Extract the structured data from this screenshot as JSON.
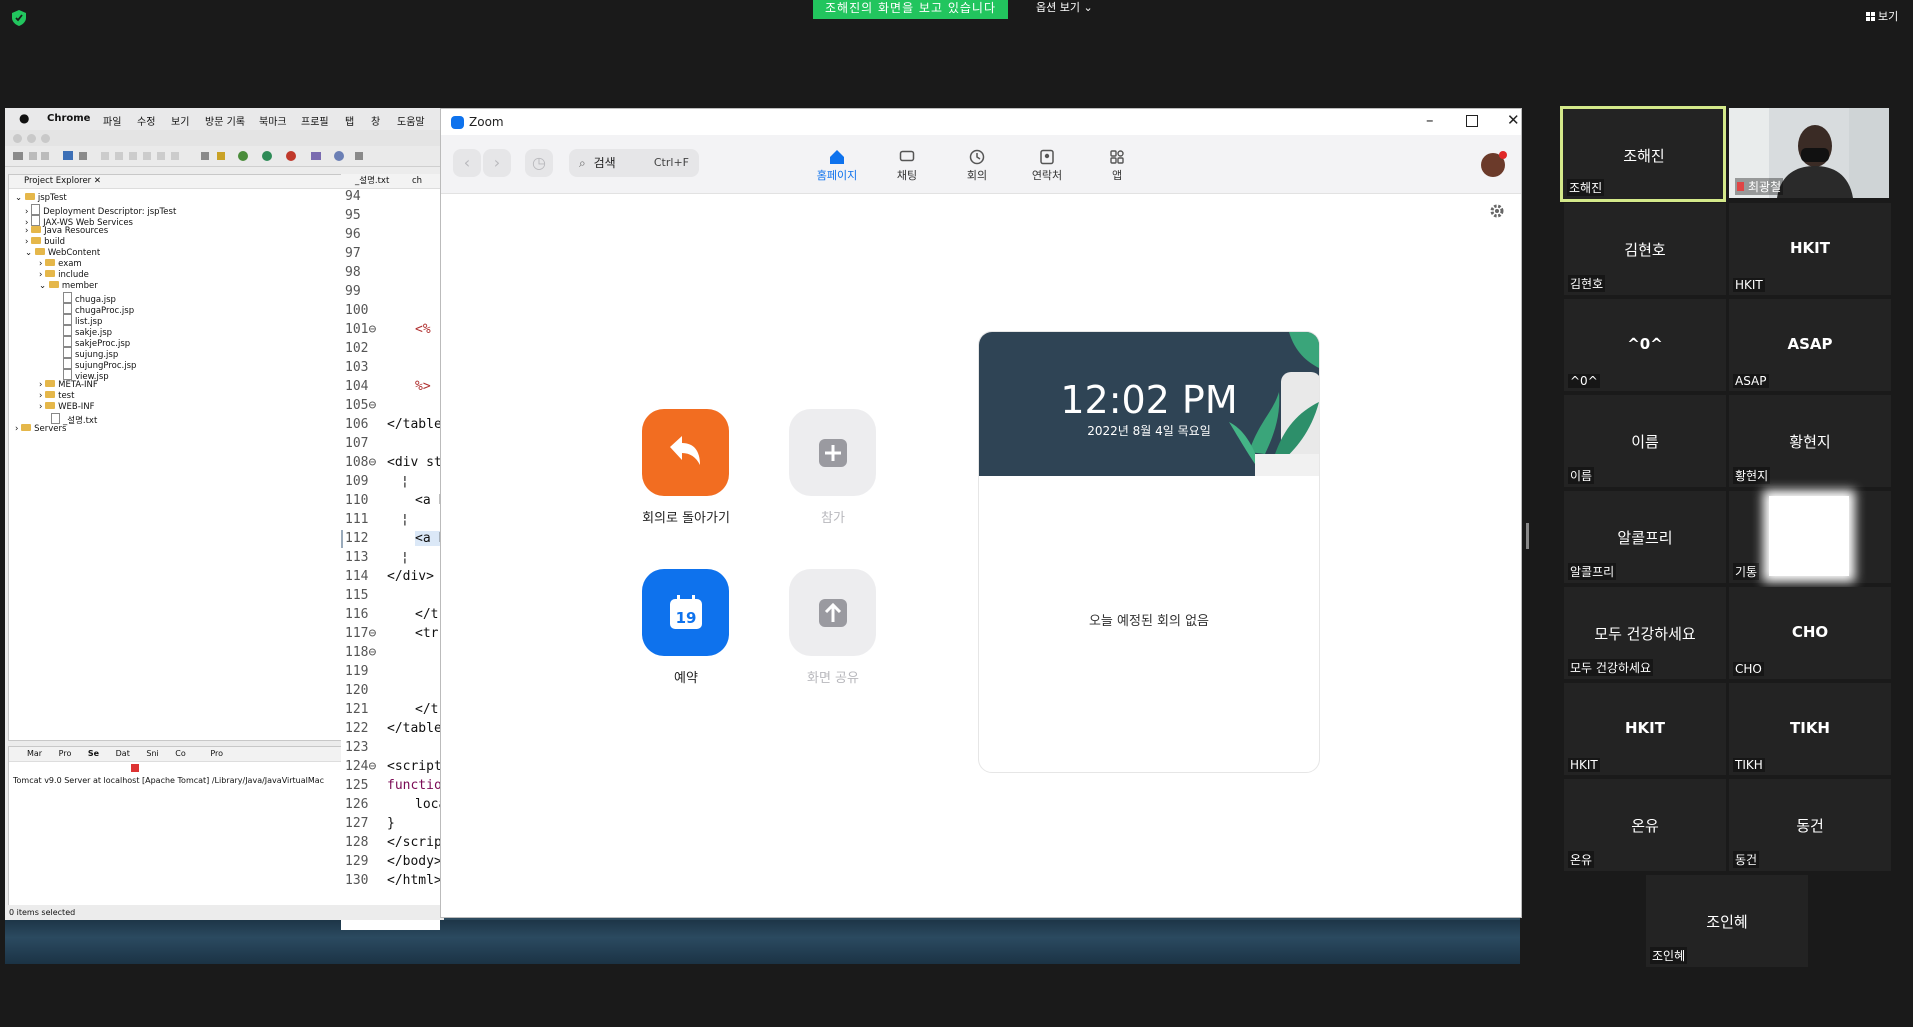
{
  "banner": {
    "viewing": "조해진의 화면을 보고 있습니다",
    "view_options": "옵션 보기 ⌄",
    "view": "보기"
  },
  "mac_menu": [
    "Chrome",
    "파일",
    "수정",
    "보기",
    "방문 기록",
    "북마크",
    "프로필",
    "탭",
    "창",
    "도움말"
  ],
  "eclipse": {
    "explorer_title": "Project Explorer",
    "tree": [
      "jspTest",
      "Deployment Descriptor: jspTest",
      "JAX-WS Web Services",
      "Java Resources",
      "build",
      "WebContent",
      "exam",
      "include",
      "member",
      "chuga.jsp",
      "chugaProc.jsp",
      "list.jsp",
      "sakje.jsp",
      "sakjeProc.jsp",
      "sujung.jsp",
      "sujungProc.jsp",
      "view.jsp",
      "META-INF",
      "test",
      "WEB-INF",
      "_설명.txt",
      "Servers"
    ],
    "editor_tab": "_설명.txt",
    "editor_tab2": "ch",
    "line_numbers": [
      "94",
      "95",
      "96",
      "97",
      "98",
      "99",
      "100",
      "101⊖",
      "102",
      "103",
      "104",
      "105⊖",
      "106",
      "107",
      "108⊖",
      "109",
      "110",
      "111",
      "112",
      "113",
      "114",
      "115",
      "116",
      "117⊖",
      "118⊖",
      "119",
      "120",
      "121",
      "122",
      "123",
      "124⊖",
      "125",
      "126",
      "127",
      "128",
      "129",
      "130"
    ],
    "code": {
      "101": "<%",
      "104": "%>",
      "106": "</table",
      "108": "<div sty",
      "109": "¦",
      "110": "<a h",
      "111": "¦",
      "112": "<a h",
      "113": "¦",
      "114": "</div>",
      "116": "</t",
      "117": "<tr",
      "121": "</t",
      "122": "</table",
      "124": "<script",
      "125": "function",
      "126": "loca",
      "127": "}",
      "128": "</scrip",
      "129": "</body>",
      "130": "</html>"
    },
    "console_tabs": [
      "Mar",
      "Pro",
      "Se",
      "Dat",
      "Sni",
      "Co",
      "Pro"
    ],
    "console_text": "Tomcat v9.0 Server at localhost [Apache Tomcat] /Library/Java/JavaVirtualMac",
    "status": "0 items selected"
  },
  "zoom": {
    "title": "Zoom",
    "search_label": "검색",
    "search_shortcut": "Ctrl+F",
    "tabs": [
      "홈페이지",
      "채팅",
      "회의",
      "연락처",
      "앱"
    ],
    "actions": {
      "return": "회의로 돌아가기",
      "join": "참가",
      "schedule": "예약",
      "share": "화면 공유",
      "calendar_day": "19"
    },
    "clock": {
      "time": "12:02 PM",
      "date": "2022년 8월 4일 목요일"
    },
    "no_meetings": "오늘 예정된 회의 없음"
  },
  "participants": [
    {
      "name": "조해진",
      "label": "조해진"
    },
    {
      "name": "",
      "label": "최광철"
    },
    {
      "name": "김현호",
      "label": "김현호"
    },
    {
      "name": "HKIT",
      "label": "HKIT"
    },
    {
      "name": "^0^",
      "label": "^0^"
    },
    {
      "name": "ASAP",
      "label": "ASAP"
    },
    {
      "name": "이름",
      "label": "이름"
    },
    {
      "name": "황현지",
      "label": "황현지"
    },
    {
      "name": "알콜프리",
      "label": "알콜프리"
    },
    {
      "name": "",
      "label": "기통"
    },
    {
      "name": "모두 건강하세요",
      "label": "모두 건강하세요"
    },
    {
      "name": "CHO",
      "label": "CHO"
    },
    {
      "name": "HKIT",
      "label": "HKIT"
    },
    {
      "name": "TIKH",
      "label": "TIKH"
    },
    {
      "name": "온유",
      "label": "온유"
    },
    {
      "name": "동건",
      "label": "동건"
    },
    {
      "name": "조인혜",
      "label": "조인혜"
    }
  ],
  "colors": {
    "accent_blue": "#0e72ed",
    "orange": "#f26d21",
    "share_green": "#22c55e",
    "active_speaker": "#d4e98a"
  }
}
